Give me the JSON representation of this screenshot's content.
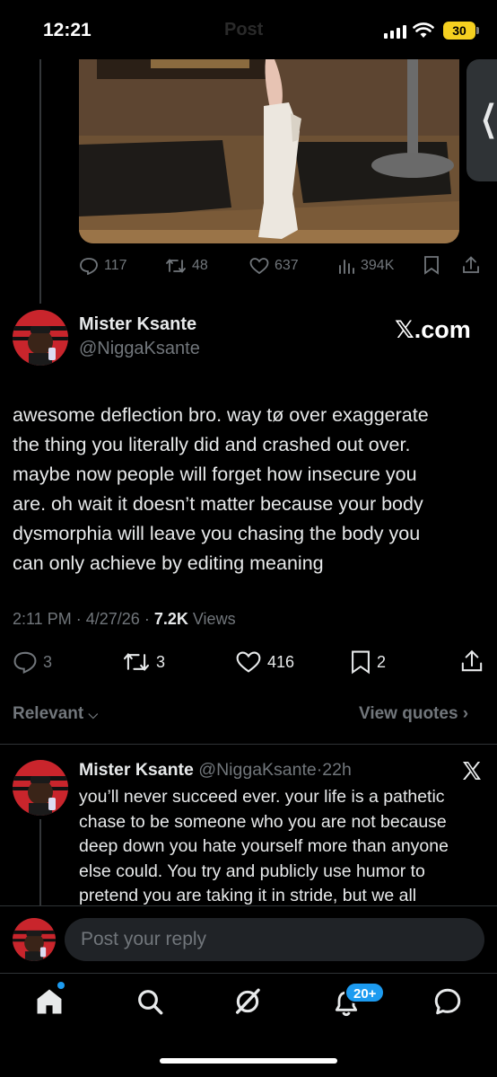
{
  "status_bar": {
    "time": "12:21",
    "battery": "30"
  },
  "header": {
    "title": "Post"
  },
  "previous_post_actions": {
    "replies": "117",
    "reposts": "48",
    "likes": "637",
    "views": "394K"
  },
  "main_post": {
    "author_name": "Mister Ksante",
    "author_handle": "@NiggaKsante",
    "watermark": "𝕏.com",
    "text_lines": [
      "awesome deflection bro. way tø over exaggerate",
      "the thing you literally did and crashed out over.",
      "maybe now people will forget how insecure you",
      "are. oh wait it doesn’t matter because your body",
      "dysmorphia will leave you chasing the body you",
      "can only achieve by editing meaning"
    ],
    "time": "2:11 PM",
    "date": "4/27/26",
    "views_count": "7.2K",
    "views_label": "Views",
    "replies": "3",
    "reposts": "3",
    "likes": "416",
    "bookmarks": "2"
  },
  "sort": {
    "relevant_label": "Relevant",
    "view_quotes_label": "View quotes"
  },
  "reply": {
    "author_name": "Mister Ksante",
    "author_handle": "@NiggaKsante",
    "age": "22h",
    "text_lines": [
      "you’ll never succeed ever. your life is a pathetic",
      "chase to be someone who you are not because",
      "deep down you hate yourself more than anyone",
      "else could. You try and publicly use humor to",
      "pretend you are taking it in stride, but we all"
    ]
  },
  "composer": {
    "placeholder": "Post your reply"
  },
  "tabbar": {
    "notifications_badge": "20+"
  },
  "colors": {
    "accent": "#1d9bf0",
    "background": "#000000",
    "muted": "#71767b",
    "text": "#e7e9ea",
    "battery": "#f5d020"
  },
  "icons": [
    "reply-icon",
    "repost-icon",
    "like-icon",
    "views-icon",
    "bookmark-icon",
    "share-icon",
    "x-logo-icon",
    "home-icon",
    "search-icon",
    "grok-icon",
    "notifications-icon",
    "messages-icon"
  ]
}
